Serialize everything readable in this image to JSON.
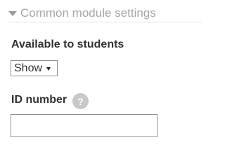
{
  "section": {
    "title": "Common module settings",
    "icon": "chevron-down-icon",
    "expanded": true
  },
  "availability": {
    "label": "Available to students",
    "selected": "Show"
  },
  "id_number": {
    "label": "ID number",
    "help_symbol": "?",
    "help_icon": "help-icon",
    "value": "",
    "placeholder": ""
  }
}
